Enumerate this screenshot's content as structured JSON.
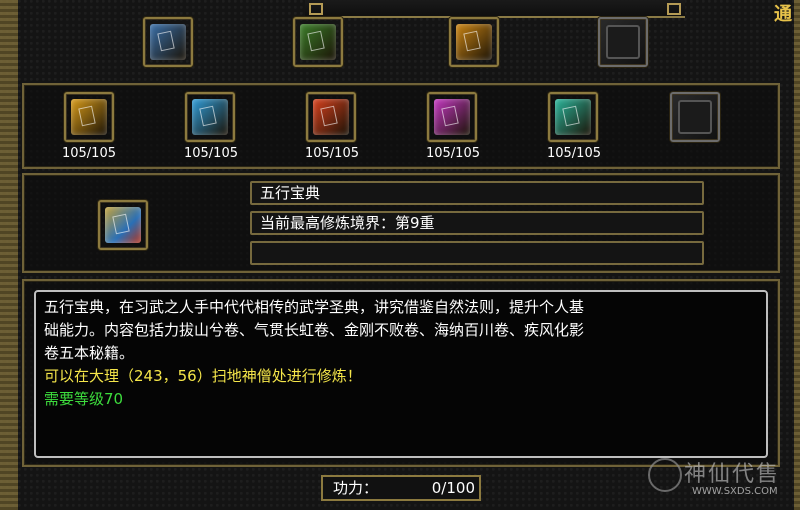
{
  "top_row": {
    "slots": [
      {
        "icon": "golden-book-icon",
        "color": "#3a6fa8",
        "state": "filled"
      },
      {
        "icon": "scroll-bundle-icon",
        "color": "#3c7d2a",
        "state": "filled"
      },
      {
        "icon": "gold-treasure-icon",
        "color": "#c98414",
        "state": "filled"
      },
      {
        "icon": "empty-slot-icon",
        "color": "#222222",
        "state": "empty"
      }
    ]
  },
  "books": [
    {
      "icon": "yellow-book-icon",
      "color": "#d69a1a",
      "count": "105/105"
    },
    {
      "icon": "blue-book-icon",
      "color": "#2f9bd6",
      "count": "105/105"
    },
    {
      "icon": "red-book-icon",
      "color": "#d5401d",
      "count": "105/105"
    },
    {
      "icon": "purple-book-icon",
      "color": "#c338c0",
      "count": "105/105"
    },
    {
      "icon": "green-book-icon",
      "color": "#2bb49a",
      "count": "105/105"
    },
    {
      "icon": "empty-slot-icon",
      "color": "#222222",
      "count": ""
    }
  ],
  "selected": {
    "icon": "wuxing-book-icon",
    "name": "五行宝典",
    "realm": "当前最高修炼境界：第9重",
    "extra": ""
  },
  "description": {
    "line1": "五行宝典，在习武之人手中代代相传的武学圣典，讲究借鉴自然法则，提升个人基",
    "line2": "础能力。内容包括力拔山兮卷、气贯长虹卷、金刚不败卷、海纳百川卷、疾风化影",
    "line3": "卷五本秘籍。",
    "location": "可以在大理（243，56）扫地神僧处进行修炼！",
    "requirement": "需要等级70"
  },
  "gongli": {
    "label": "功力：",
    "value": "0/100"
  },
  "corner_glyph": "通",
  "watermark": {
    "name": "神仙代售",
    "url": "WWW.SXDS.COM"
  },
  "colors": {
    "border_gold": "#8c7a3f",
    "text_yellow": "#f5e64a",
    "text_green": "#3ddc3d"
  }
}
